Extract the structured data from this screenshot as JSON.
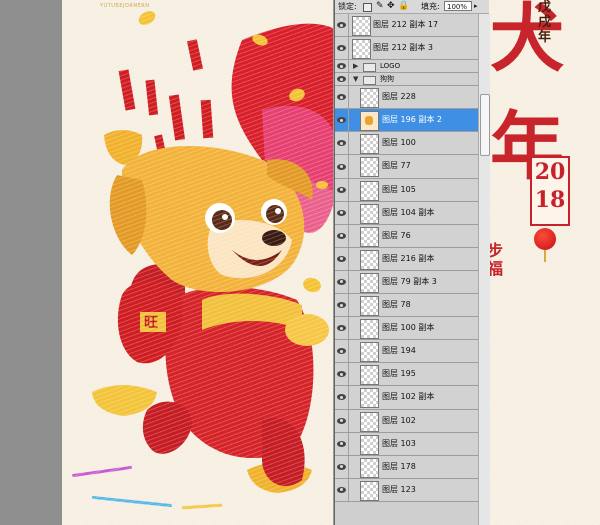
{
  "colors": {
    "panel_bg": "#d2d2d2",
    "selected_row": "#3f8fe4",
    "poster_red": "#c7242b",
    "dog_gold": "#f3b33a"
  },
  "canvas": {
    "top_small_text": "YUTUBEJORNERN",
    "year_vertical": [
      "戊",
      "戌",
      "年"
    ],
    "title_chars": [
      "犬",
      "年"
    ],
    "seal_digits": [
      "20",
      "18"
    ],
    "blessing": [
      "步",
      "福"
    ],
    "bag_label": "旺"
  },
  "layers_panel": {
    "lock_label": "锁定:",
    "fill_label": "填充:",
    "fill_value": "100%",
    "scrollbar": "vertical-scrollbar",
    "rows": [
      {
        "name": "图层 212 副本 17",
        "kind": "layer",
        "level": "top",
        "selected": false
      },
      {
        "name": "图层 212 副本 3",
        "kind": "layer",
        "level": "top",
        "selected": false
      },
      {
        "name": "LOGO",
        "kind": "folder",
        "expanded": false
      },
      {
        "name": "狗狗",
        "kind": "folder",
        "expanded": true
      },
      {
        "name": "图层 228",
        "kind": "layer",
        "level": "child",
        "selected": false
      },
      {
        "name": "图层 196 副本 2",
        "kind": "layer",
        "level": "child",
        "selected": true
      },
      {
        "name": "图层 100",
        "kind": "layer",
        "level": "child",
        "selected": false
      },
      {
        "name": "图层 77",
        "kind": "layer",
        "level": "child",
        "selected": false
      },
      {
        "name": "图层 105",
        "kind": "layer",
        "level": "child",
        "selected": false
      },
      {
        "name": "图层 104 副本",
        "kind": "layer",
        "level": "child",
        "selected": false
      },
      {
        "name": "图层 76",
        "kind": "layer",
        "level": "child",
        "selected": false
      },
      {
        "name": "图层 216 副本",
        "kind": "layer",
        "level": "child",
        "selected": false
      },
      {
        "name": "图层 79 副本 3",
        "kind": "layer",
        "level": "child",
        "selected": false
      },
      {
        "name": "图层 78",
        "kind": "layer",
        "level": "child",
        "selected": false
      },
      {
        "name": "图层 100 副本",
        "kind": "layer",
        "level": "child",
        "selected": false
      },
      {
        "name": "图层 194",
        "kind": "layer",
        "level": "child",
        "selected": false
      },
      {
        "name": "图层 195",
        "kind": "layer",
        "level": "child",
        "selected": false
      },
      {
        "name": "图层 102 副本",
        "kind": "layer",
        "level": "child",
        "selected": false
      },
      {
        "name": "图层 102",
        "kind": "layer",
        "level": "child",
        "selected": false
      },
      {
        "name": "图层 103",
        "kind": "layer",
        "level": "child",
        "selected": false
      },
      {
        "name": "图层 178",
        "kind": "layer",
        "level": "child",
        "selected": false
      },
      {
        "name": "图层 123",
        "kind": "layer",
        "level": "child",
        "selected": false
      }
    ]
  }
}
